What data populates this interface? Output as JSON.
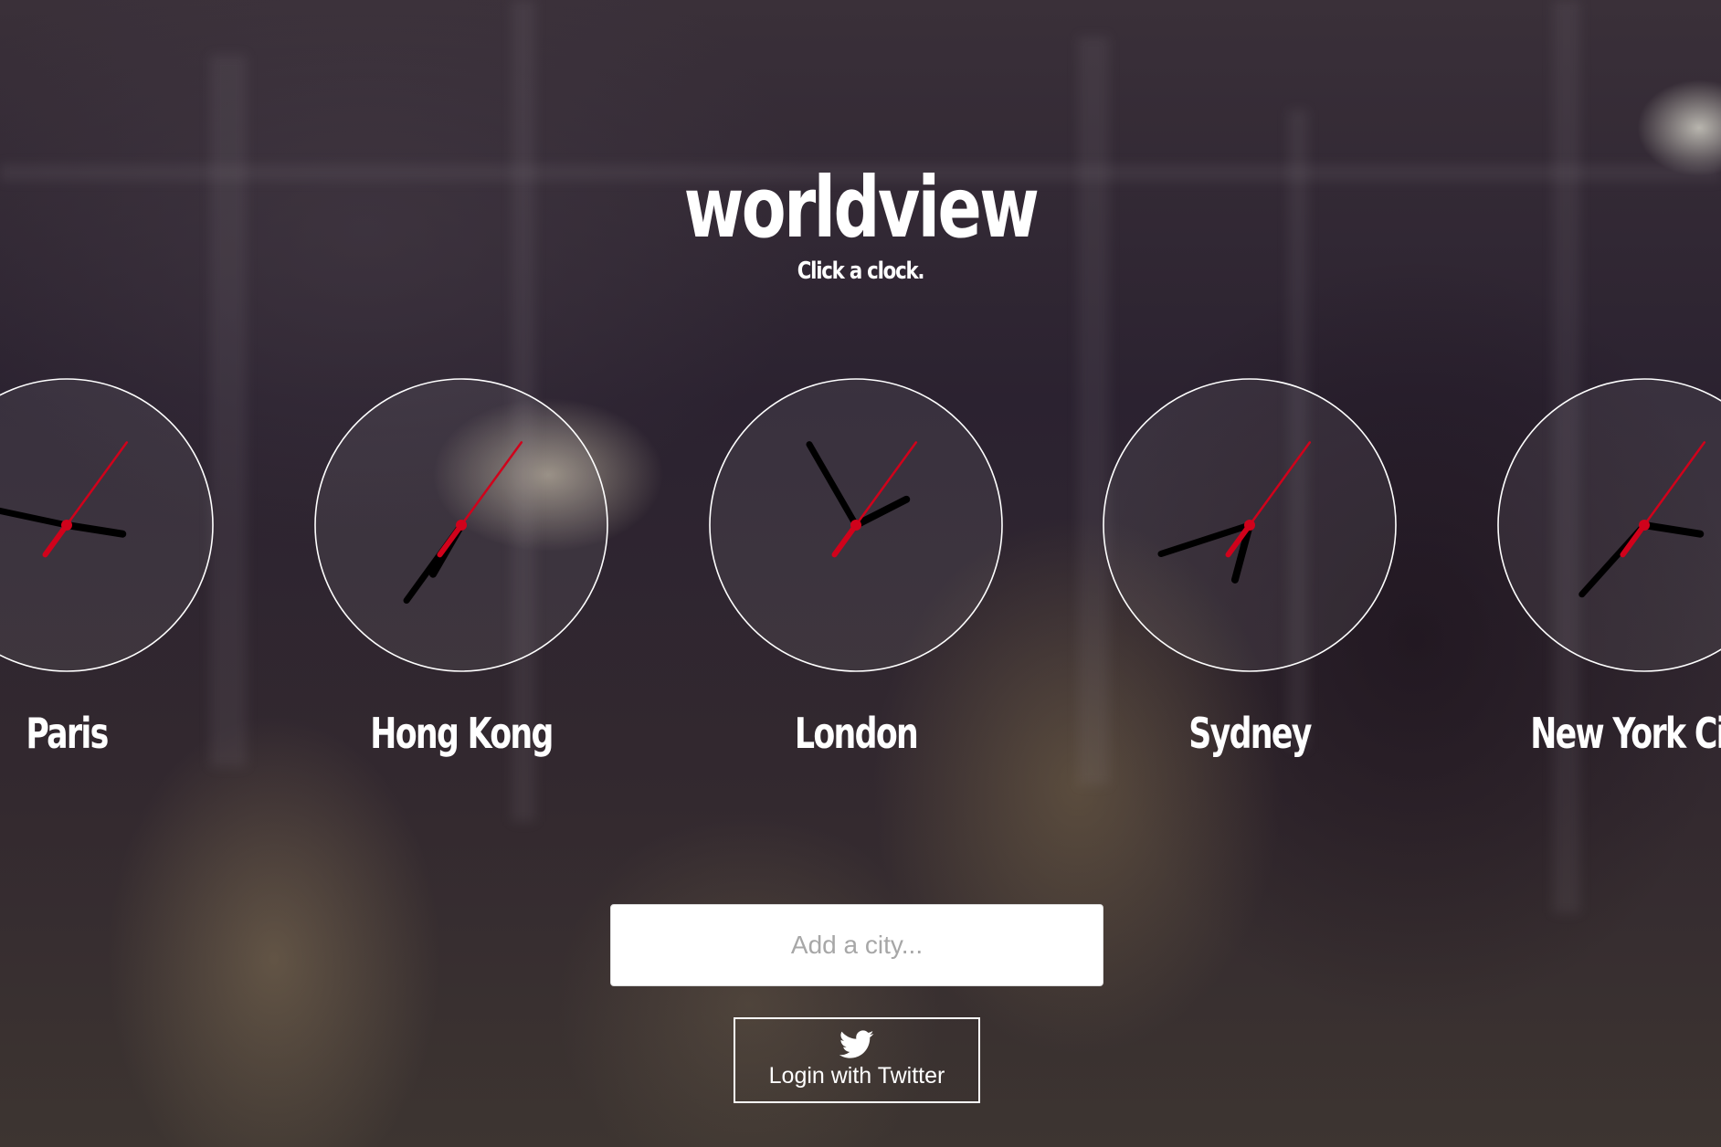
{
  "app": {
    "title": "worldview",
    "subtitle": "Click a clock."
  },
  "clocks": [
    {
      "city": "Paris",
      "hour": 3.3,
      "minute": 47,
      "second": 36
    },
    {
      "city": "Hong Kong",
      "hour": 7.0,
      "minute": 36,
      "second": 36
    },
    {
      "city": "London",
      "hour": 2.1,
      "minute": 55,
      "second": 36
    },
    {
      "city": "Sydney",
      "hour": 6.5,
      "minute": 42,
      "second": 36
    },
    {
      "city": "New York City",
      "hour": 3.3,
      "minute": 37,
      "second": 36
    }
  ],
  "search": {
    "placeholder": "Add a city..."
  },
  "login": {
    "label": "Login with Twitter",
    "icon": "twitter-bird-icon"
  },
  "colors": {
    "second_hand": "#d0021b",
    "hands": "#000000",
    "clock_face": "rgba(255,255,255,0.07)",
    "clock_rim": "#ffffff"
  }
}
